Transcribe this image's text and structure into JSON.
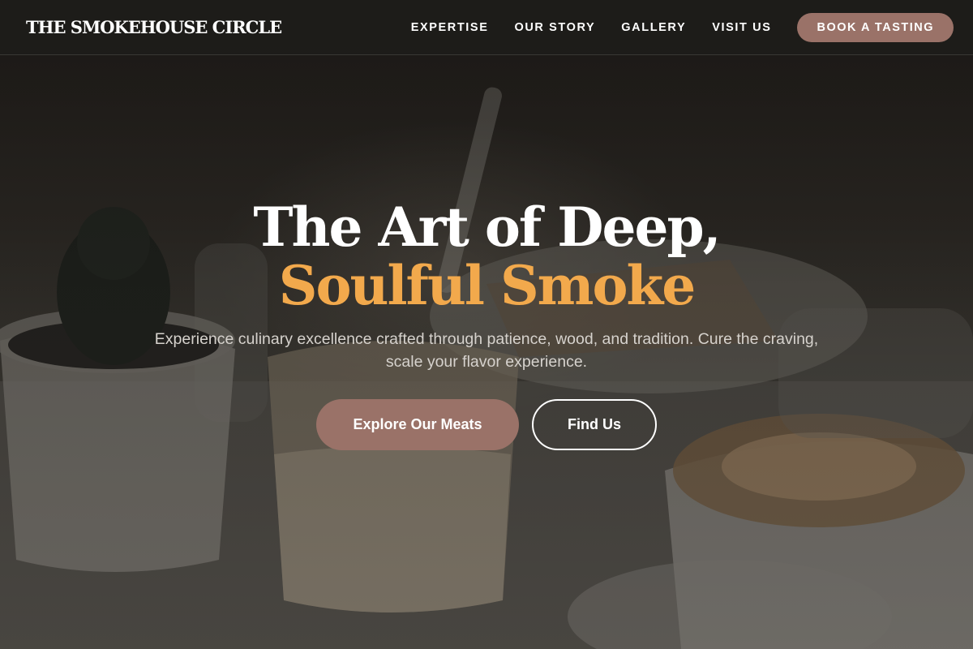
{
  "nav": {
    "logo": "THE SMOKEHOUSE CIRCLE",
    "links": [
      "EXPERTISE",
      "OUR STORY",
      "GALLERY",
      "VISIT US"
    ],
    "cta": "BOOK A TASTING"
  },
  "hero": {
    "headline_line1": "The Art of Deep,",
    "headline_line2": "Soulful Smoke",
    "subtitle": "Experience culinary excellence crafted through patience, wood, and tradition. Cure the craving, scale your flavor experience.",
    "primary_button": "Explore Our Meats",
    "secondary_button": "Find Us"
  },
  "colors": {
    "accent": "#f2a94c",
    "button": "#9a7268",
    "nav_background": "#1e1c1a",
    "text": "#ffffff"
  }
}
